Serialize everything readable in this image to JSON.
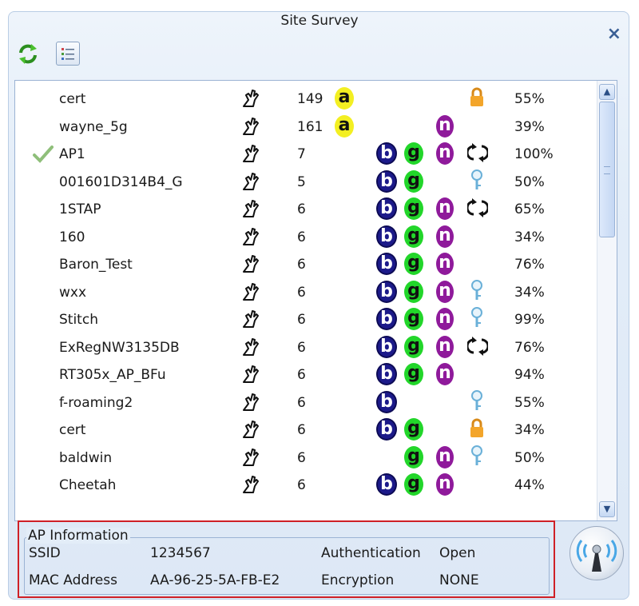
{
  "window": {
    "title": "Site Survey",
    "close": "×"
  },
  "toolbar": {
    "refresh_icon": "refresh-icon",
    "list_icon": "list-view-icon"
  },
  "networks": [
    {
      "ssid": "cert",
      "channel": "149",
      "a": true,
      "b": false,
      "g": false,
      "n": false,
      "security": "lock",
      "signal": "55%",
      "connected": false
    },
    {
      "ssid": "wayne_5g",
      "channel": "161",
      "a": true,
      "b": false,
      "g": false,
      "n": true,
      "security": "",
      "signal": "39%",
      "connected": false
    },
    {
      "ssid": "AP1",
      "channel": "7",
      "a": false,
      "b": true,
      "g": true,
      "n": true,
      "security": "wps",
      "signal": "100%",
      "connected": true
    },
    {
      "ssid": "001601D314B4_G",
      "channel": "5",
      "a": false,
      "b": true,
      "g": true,
      "n": false,
      "security": "key",
      "signal": "50%",
      "connected": false
    },
    {
      "ssid": "1STAP",
      "channel": "6",
      "a": false,
      "b": true,
      "g": true,
      "n": true,
      "security": "wps",
      "signal": "65%",
      "connected": false
    },
    {
      "ssid": "160",
      "channel": "6",
      "a": false,
      "b": true,
      "g": true,
      "n": true,
      "security": "",
      "signal": "34%",
      "connected": false
    },
    {
      "ssid": "Baron_Test",
      "channel": "6",
      "a": false,
      "b": true,
      "g": true,
      "n": true,
      "security": "",
      "signal": "76%",
      "connected": false
    },
    {
      "ssid": "wxx",
      "channel": "6",
      "a": false,
      "b": true,
      "g": true,
      "n": true,
      "security": "key",
      "signal": "34%",
      "connected": false
    },
    {
      "ssid": "Stitch",
      "channel": "6",
      "a": false,
      "b": true,
      "g": true,
      "n": true,
      "security": "key",
      "signal": "99%",
      "connected": false
    },
    {
      "ssid": "ExRegNW3135DB",
      "channel": "6",
      "a": false,
      "b": true,
      "g": true,
      "n": true,
      "security": "wps",
      "signal": "76%",
      "connected": false
    },
    {
      "ssid": "RT305x_AP_BFu",
      "channel": "6",
      "a": false,
      "b": true,
      "g": true,
      "n": true,
      "security": "",
      "signal": "94%",
      "connected": false
    },
    {
      "ssid": "f-roaming2",
      "channel": "6",
      "a": false,
      "b": true,
      "g": false,
      "n": false,
      "security": "key",
      "signal": "55%",
      "connected": false
    },
    {
      "ssid": "cert",
      "channel": "6",
      "a": false,
      "b": true,
      "g": true,
      "n": false,
      "security": "lock",
      "signal": "34%",
      "connected": false
    },
    {
      "ssid": "baldwin",
      "channel": "6",
      "a": false,
      "b": false,
      "g": true,
      "n": true,
      "security": "key",
      "signal": "50%",
      "connected": false
    },
    {
      "ssid": "Cheetah",
      "channel": "6",
      "a": false,
      "b": true,
      "g": true,
      "n": true,
      "security": "",
      "signal": "44%",
      "connected": false
    }
  ],
  "badges": {
    "a": "a",
    "b": "b",
    "g": "g",
    "n": "n"
  },
  "ap_info": {
    "legend": "AP Information",
    "ssid_label": "SSID",
    "ssid_value": "1234567",
    "mac_label": "MAC Address",
    "mac_value": "AA-96-25-5A-FB-E2",
    "auth_label": "Authentication",
    "auth_value": "Open",
    "enc_label": "Encryption",
    "enc_value": "NONE"
  },
  "colors": {
    "accent": "#cf2026",
    "band_a": "#f3ef22",
    "band_b": "#1c1a8a",
    "band_g": "#22d62a",
    "band_n": "#8f1a9b"
  }
}
